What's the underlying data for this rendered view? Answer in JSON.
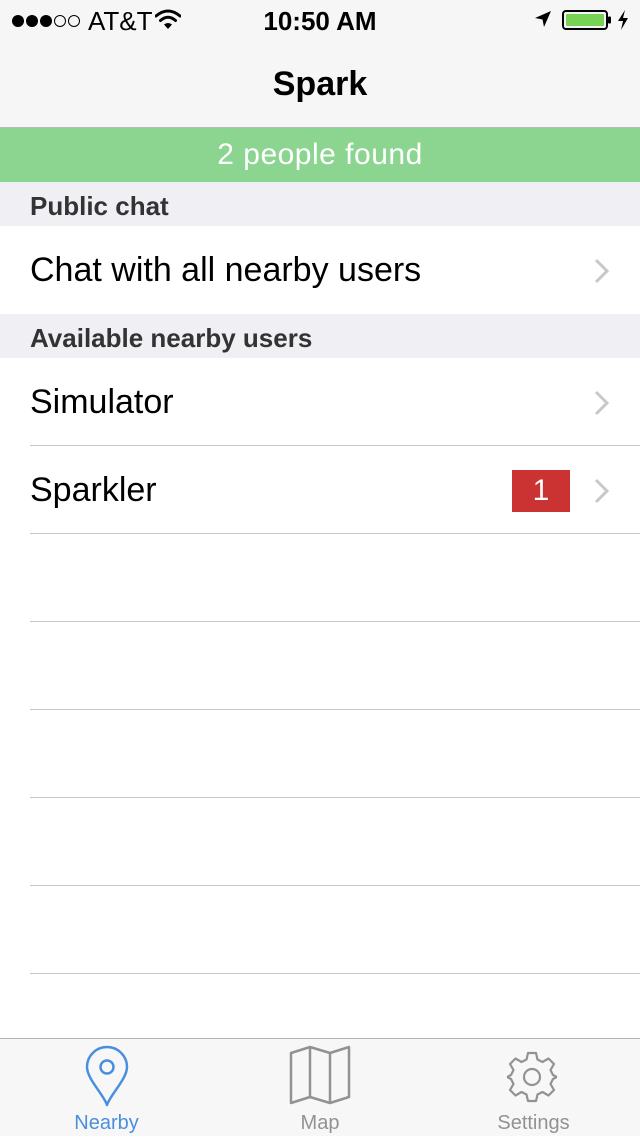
{
  "status_bar": {
    "signal_strength": "3 of 5",
    "carrier": "AT&T",
    "time": "10:50 AM",
    "battery_color": "#77d353"
  },
  "nav": {
    "title": "Spark"
  },
  "banner": {
    "text": "2 people found",
    "color": "#8cd591"
  },
  "sections": [
    {
      "header": "Public chat",
      "rows": [
        {
          "label": "Chat with all nearby users"
        }
      ]
    },
    {
      "header": "Available nearby users",
      "rows": [
        {
          "label": "Simulator"
        },
        {
          "label": "Sparkler",
          "badge": "1"
        }
      ]
    }
  ],
  "badge_color": "#cb3232",
  "tabbar": {
    "active_color": "#4a8fde",
    "inactive_color": "#929292",
    "tabs": [
      {
        "label": "Nearby",
        "icon": "location-pin-icon",
        "active": true
      },
      {
        "label": "Map",
        "icon": "map-icon",
        "active": false
      },
      {
        "label": "Settings",
        "icon": "gear-icon",
        "active": false
      }
    ]
  }
}
